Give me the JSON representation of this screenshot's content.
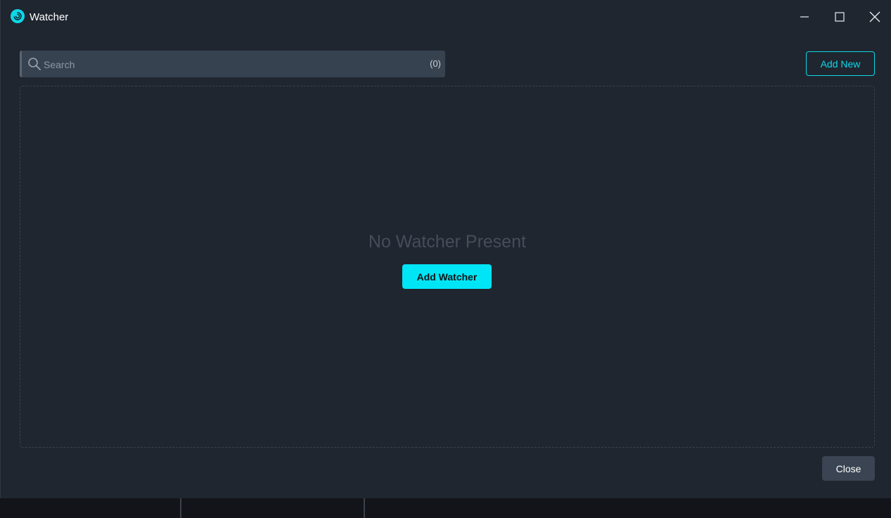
{
  "window": {
    "title": "Watcher",
    "icon": "watcher-swirl-icon",
    "controls": [
      "minimize-icon",
      "maximize-icon",
      "close-icon"
    ]
  },
  "search": {
    "placeholder": "Search",
    "value": "",
    "count": "(0)"
  },
  "toolbar": {
    "add_new_label": "Add New"
  },
  "empty_state": {
    "message": "No Watcher Present",
    "add_watcher_label": "Add Watcher"
  },
  "footer": {
    "close_label": "Close"
  },
  "colors": {
    "accent": "#00e5f5",
    "background": "#1f2630",
    "input_background": "#374250",
    "muted_text": "#444d59"
  }
}
